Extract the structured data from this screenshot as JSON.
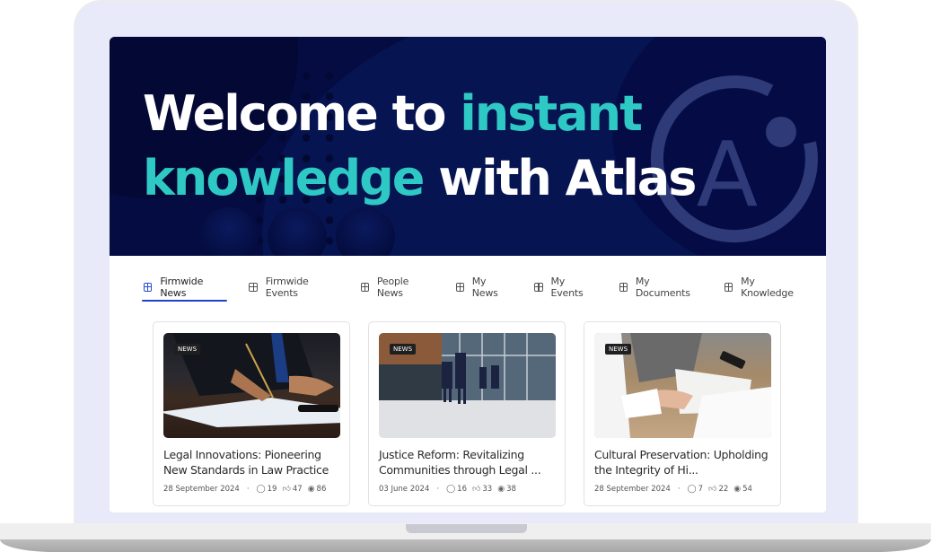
{
  "hero": {
    "line1_white": "Welcome to ",
    "line1_accent": "instant",
    "line2_accent": "knowledge",
    "line2_white": " with Atlas",
    "logo_letter": "A",
    "accent_color": "#2ec9c5",
    "background_color": "#040c42"
  },
  "tabs": [
    {
      "label": "Firmwide News",
      "icon": "grid-icon",
      "active": true
    },
    {
      "label": "Firmwide Events",
      "icon": "grid-icon",
      "active": false
    },
    {
      "label": "People News",
      "icon": "grid-icon",
      "active": false
    },
    {
      "label": "My News",
      "icon": "grid-icon",
      "active": false
    },
    {
      "label": "My Events",
      "icon": "grid-icon",
      "active": false
    },
    {
      "label": "My Documents",
      "icon": "grid-icon",
      "active": false
    },
    {
      "label": "My Knowledge",
      "icon": "grid-icon",
      "active": false
    }
  ],
  "cards": [
    {
      "badge": "NEWS",
      "image": "person signing legal document with pen",
      "title": "Legal Innovations: Pioneering New Standards in Law Practice",
      "date": "28 September 2024",
      "comments": "19",
      "likes": "47",
      "views": "86"
    },
    {
      "badge": "NEWS",
      "image": "business people walking outside glass office building",
      "title": "Justice Reform: Revitalizing Communities through Legal ...",
      "date": "03 June 2024",
      "comments": "16",
      "likes": "33",
      "views": "38"
    },
    {
      "badge": "NEWS",
      "image": "hands reviewing paperwork on wooden desk",
      "title": "Cultural Preservation: Upholding the Integrity of Hi...",
      "date": "28 September 2024",
      "comments": "7",
      "likes": "22",
      "views": "54"
    }
  ],
  "meta_separator": "·",
  "icons": {
    "comment": "comment-icon",
    "like": "like-icon",
    "view": "eye-icon"
  }
}
